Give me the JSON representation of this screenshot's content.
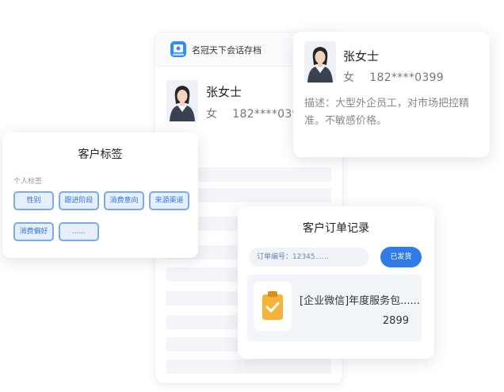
{
  "archive": {
    "app_name": "名冠天下会话存档",
    "customer": {
      "name": "张女士",
      "info": "女    182****0399"
    }
  },
  "profile": {
    "customer": {
      "name": "张女士",
      "info": "女    182****0399"
    },
    "description": "描述：大型外企员工，对市场把控精准。不敏感价格。"
  },
  "tags": {
    "title": "客户标签",
    "section_label": "个人标签",
    "items": [
      "性别",
      "跟进阶段",
      "消费意向",
      "来源渠道",
      "消费偏好",
      "......"
    ]
  },
  "orders": {
    "title": "客户订单记录",
    "order_no_placeholder": "订单编号：12345......",
    "status_button": "已发货",
    "item": {
      "name": "[企业微信]年度服务包......",
      "price": "2899"
    }
  },
  "colors": {
    "accent": "#2f7be8",
    "tag_border": "#7aaaf0",
    "tag_bg": "#e6f0fd",
    "clipboard": "#f4b43a"
  }
}
